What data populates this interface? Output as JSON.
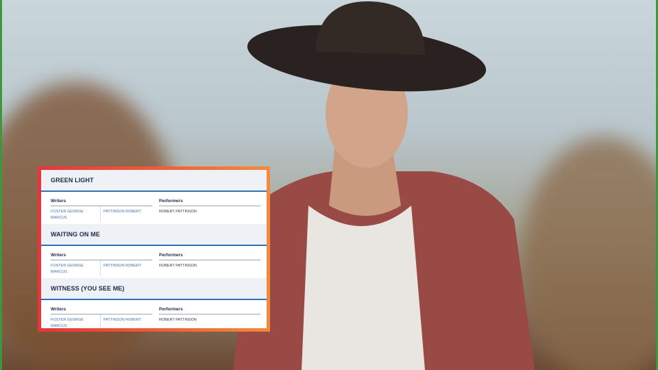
{
  "songs": [
    {
      "title": "GREEN LIGHT",
      "writers_label": "Writers",
      "performers_label": "Performers",
      "writers": [
        "FOSTER GEORGE MARCUS",
        "PATTINSON ROBERT"
      ],
      "performers": [
        "ROBERT PATTINSON"
      ]
    },
    {
      "title": "WAITING ON ME",
      "writers_label": "Writers",
      "performers_label": "Performers",
      "writers": [
        "FOSTER GEORGE MARCUS",
        "PATTINSON ROBERT"
      ],
      "performers": [
        "ROBERT PATTINSON"
      ]
    },
    {
      "title": "WITNESS (YOU SEE ME)",
      "writers_label": "Writers",
      "performers_label": "Performers",
      "writers": [
        "FOSTER GEORGE MARCUS",
        "PATTINSON ROBERT"
      ],
      "performers": [
        "ROBERT PATTINSON"
      ]
    }
  ],
  "colors": {
    "frame_left": "#e8343a",
    "frame_right": "#f58a3a",
    "accent_line": "#2f6fb3",
    "writer_link": "#3f74b8",
    "title_text": "#1a2a4a"
  }
}
